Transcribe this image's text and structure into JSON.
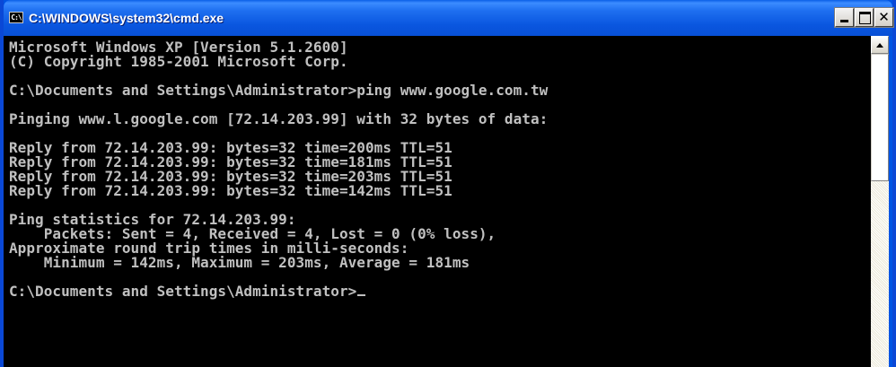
{
  "window": {
    "title": "C:\\WINDOWS\\system32\\cmd.exe",
    "icon": "cmd-icon",
    "icon_text": "C:\\",
    "controls": {
      "minimize": "minimize-icon",
      "maximize": "maximize-icon",
      "close_label": "✕"
    }
  },
  "console": {
    "lines": [
      "Microsoft Windows XP [Version 5.1.2600]",
      "(C) Copyright 1985-2001 Microsoft Corp.",
      "",
      "C:\\Documents and Settings\\Administrator>ping www.google.com.tw",
      "",
      "Pinging www.l.google.com [72.14.203.99] with 32 bytes of data:",
      "",
      "Reply from 72.14.203.99: bytes=32 time=200ms TTL=51",
      "Reply from 72.14.203.99: bytes=32 time=181ms TTL=51",
      "Reply from 72.14.203.99: bytes=32 time=203ms TTL=51",
      "Reply from 72.14.203.99: bytes=32 time=142ms TTL=51",
      "",
      "Ping statistics for 72.14.203.99:",
      "    Packets: Sent = 4, Received = 4, Lost = 0 (0% loss),",
      "Approximate round trip times in milli-seconds:",
      "    Minimum = 142ms, Maximum = 203ms, Average = 181ms",
      ""
    ],
    "prompt": "C:\\Documents and Settings\\Administrator>",
    "colors": {
      "background": "#000000",
      "foreground": "#c0c0c0"
    }
  },
  "colors": {
    "titlebar": "#0a56df",
    "title_text": "#ffffff"
  }
}
